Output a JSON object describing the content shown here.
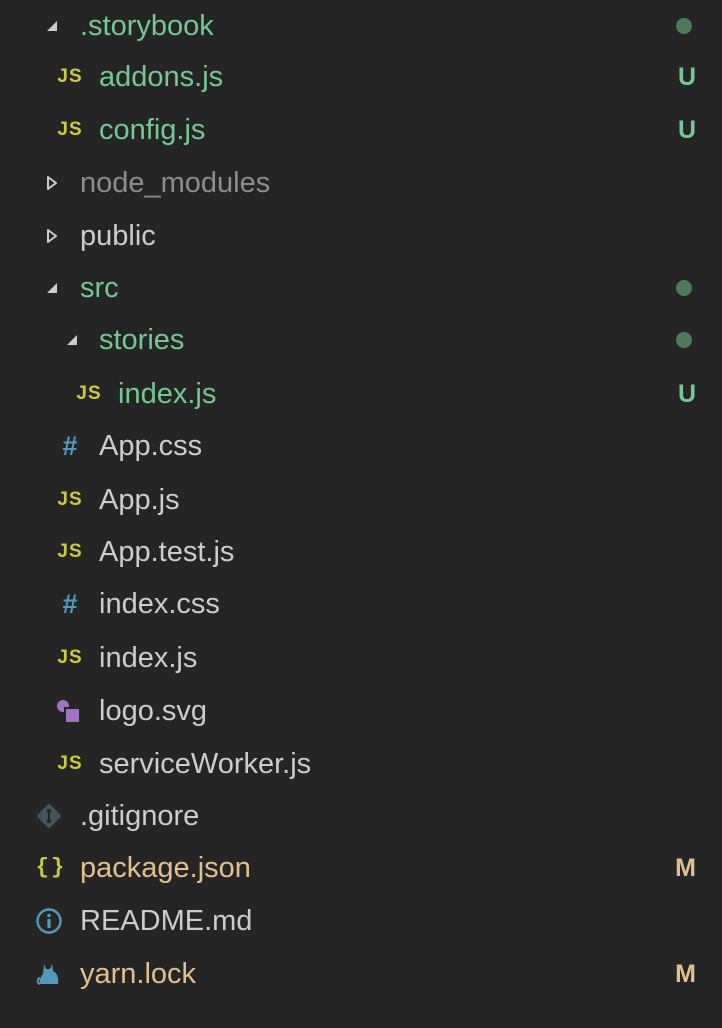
{
  "colors": {
    "background": "#252526",
    "untracked": "#73c991",
    "modified": "#e2c08d",
    "ignored": "#8c8c8c",
    "default": "#cccccc",
    "dot": "#4f7a5a"
  },
  "explorer": {
    "items": [
      {
        "name": ".storybook",
        "type": "folder",
        "expanded": true,
        "icon": "chevron-down-icon",
        "status": "dot"
      },
      {
        "name": "addons.js",
        "type": "file",
        "icon": "js-icon",
        "icon_text": "JS",
        "badge": "U"
      },
      {
        "name": "config.js",
        "type": "file",
        "icon": "js-icon",
        "icon_text": "JS",
        "badge": "U"
      },
      {
        "name": "node_modules",
        "type": "folder",
        "expanded": false,
        "icon": "chevron-right-icon"
      },
      {
        "name": "public",
        "type": "folder",
        "expanded": false,
        "icon": "chevron-right-icon"
      },
      {
        "name": "src",
        "type": "folder",
        "expanded": true,
        "icon": "chevron-down-icon",
        "status": "dot"
      },
      {
        "name": "stories",
        "type": "folder",
        "expanded": true,
        "icon": "chevron-down-icon",
        "status": "dot"
      },
      {
        "name": "index.js",
        "type": "file",
        "icon": "js-icon",
        "icon_text": "JS",
        "badge": "U"
      },
      {
        "name": "App.css",
        "type": "file",
        "icon": "css-hash-icon",
        "icon_text": "#"
      },
      {
        "name": "App.js",
        "type": "file",
        "icon": "js-icon",
        "icon_text": "JS"
      },
      {
        "name": "App.test.js",
        "type": "file",
        "icon": "js-icon",
        "icon_text": "JS"
      },
      {
        "name": "index.css",
        "type": "file",
        "icon": "css-hash-icon",
        "icon_text": "#"
      },
      {
        "name": "index.js",
        "type": "file",
        "icon": "js-icon",
        "icon_text": "JS"
      },
      {
        "name": "logo.svg",
        "type": "file",
        "icon": "svg-shapes-icon"
      },
      {
        "name": "serviceWorker.js",
        "type": "file",
        "icon": "js-icon",
        "icon_text": "JS"
      },
      {
        "name": ".gitignore",
        "type": "file",
        "icon": "git-icon"
      },
      {
        "name": "package.json",
        "type": "file",
        "icon": "json-braces-icon",
        "icon_text": "{}",
        "badge": "M"
      },
      {
        "name": "README.md",
        "type": "file",
        "icon": "info-icon"
      },
      {
        "name": "yarn.lock",
        "type": "file",
        "icon": "yarn-cat-icon",
        "badge": "M"
      }
    ]
  }
}
